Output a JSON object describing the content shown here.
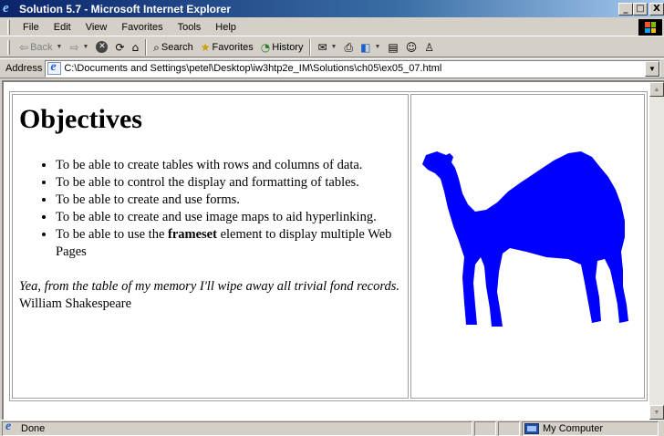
{
  "window": {
    "title": "Solution 5.7 - Microsoft Internet Explorer",
    "minimize_label": "_",
    "maximize_label": "□",
    "close_label": "X"
  },
  "menubar": {
    "items": [
      {
        "label": "File"
      },
      {
        "label": "Edit"
      },
      {
        "label": "View"
      },
      {
        "label": "Favorites"
      },
      {
        "label": "Tools"
      },
      {
        "label": "Help"
      }
    ]
  },
  "toolbar": {
    "back_label": "Back",
    "search_label": "Search",
    "favorites_label": "Favorites",
    "history_label": "History"
  },
  "addressbar": {
    "label": "Address",
    "value": "C:\\Documents and Settings\\petel\\Desktop\\iw3htp2e_IM\\Solutions\\ch05\\ex05_07.html"
  },
  "page": {
    "heading": "Objectives",
    "objectives": [
      "To be able to create tables with rows and columns of data.",
      "To be able to control the display and formatting of tables.",
      "To be able to create and use forms.",
      "To be able to create and use image maps to aid hyperlinking."
    ],
    "last_objective": {
      "before": "To be able to use the ",
      "bold": "frameset",
      "after": " element to display multiple Web Pages"
    },
    "quote": "Yea, from the table of my memory I'll wipe away all trivial fond records.",
    "author": "William Shakespeare",
    "camel_color": "#0000ff"
  },
  "statusbar": {
    "status_text": "Done",
    "zone_text": "My Computer"
  }
}
